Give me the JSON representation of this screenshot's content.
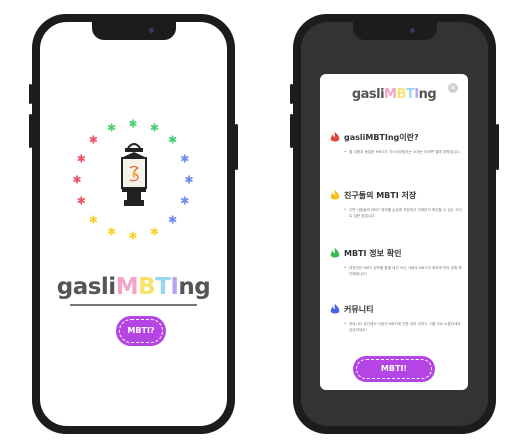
{
  "left_phone": {
    "logo": {
      "prefix": "gasli",
      "letters": [
        "M",
        "B",
        "T",
        "I"
      ],
      "suffix": "ng"
    },
    "button_label": "MBTI?",
    "star_colors": [
      "#4ccf72",
      "#4ccf72",
      "#4ccf72",
      "#6b8cf2",
      "#6b8cf2",
      "#6b8cf2",
      "#6b8cf2",
      "#f5d431",
      "#f5d431",
      "#f5d431",
      "#f5d431",
      "#ea5466",
      "#ea5466",
      "#ea5466",
      "#ea5466",
      "#4ccf72"
    ]
  },
  "right_phone": {
    "logo": {
      "prefix": "gasli",
      "letters": [
        "M",
        "B",
        "T",
        "I"
      ],
      "suffix": "ng"
    },
    "sections": [
      {
        "title": "gasliMBTIng이란?",
        "flame_color": "#e0463c",
        "desc": "별 이름과 동일한 MBTI가 가스라이팅하는 소재는 어쩌면 별에 취향입니다."
      },
      {
        "title": "친구들의 MBTI 저장",
        "flame_color": "#f2c21b",
        "desc": "주변 사람들의 MBTI 정보를 손쉽게 저장하고 언제든지 확인할 수 있는 사이트 입문 방법니다."
      },
      {
        "title": "MBTI 정보 확인",
        "flame_color": "#3fb951",
        "desc": "대표적인 MBTI 정보를 통해 내가 아닌 사람의 MBTI가 정보에 따라 정확 확인해봅니다!"
      },
      {
        "title": "커뮤니티",
        "flame_color": "#4c63e0",
        "desc": "커뮤니티 공간에서 사람의 MBTI에 관한 여러 이야기 그를 서로 소통하세요 공유하세요!"
      }
    ],
    "button_label": "MBTI!",
    "close_icon": "close-icon"
  },
  "colors": {
    "accent_purple": "#b544e4",
    "logo_M": "#f5a3c7",
    "logo_B": "#f7e36b",
    "logo_T": "#9ad7ef",
    "logo_I": "#b9a3f2",
    "logo_dark": "#555555"
  }
}
